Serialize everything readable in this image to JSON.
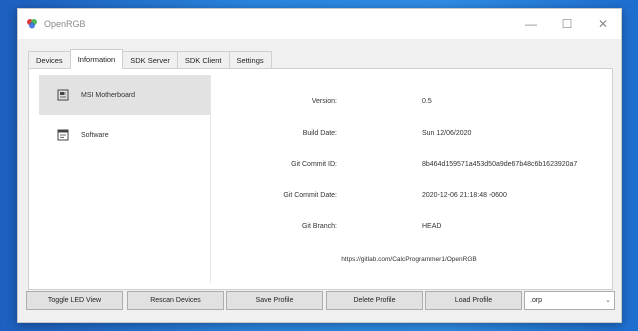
{
  "window": {
    "title": "OpenRGB"
  },
  "window_controls": {
    "minimize": "—",
    "maximize": "☐",
    "close": "✕"
  },
  "tabs": [
    {
      "label": "Devices"
    },
    {
      "label": "Information"
    },
    {
      "label": "SDK Server"
    },
    {
      "label": "SDK Client"
    },
    {
      "label": "Settings"
    }
  ],
  "sidebar": {
    "items": [
      {
        "label": "MSI Motherboard",
        "icon": "motherboard-icon"
      },
      {
        "label": "Software",
        "icon": "software-icon"
      }
    ]
  },
  "info": {
    "version_label": "Version:",
    "version_value": "0.5",
    "build_date_label": "Build Date:",
    "build_date_value": "Sun 12/06/2020",
    "git_commit_id_label": "Git Commit ID:",
    "git_commit_id_value": "8b464d159571a453d50a9de67b48c6b1623920a7",
    "git_commit_date_label": "Git Commit Date:",
    "git_commit_date_value": "2020-12-06 21:18:48 -0600",
    "git_branch_label": "Git Branch:",
    "git_branch_value": "HEAD",
    "url": "https://gitlab.com/CalcProgrammer1/OpenRGB"
  },
  "buttons": {
    "toggle_led_view": "Toggle LED View",
    "rescan_devices": "Rescan Devices",
    "save_profile": "Save Profile",
    "delete_profile": "Delete Profile",
    "load_profile": "Load Profile"
  },
  "profile_select": {
    "value": ".orp"
  },
  "colors": {
    "accent": "#2a86e0",
    "selected": "#e2e2e2"
  }
}
